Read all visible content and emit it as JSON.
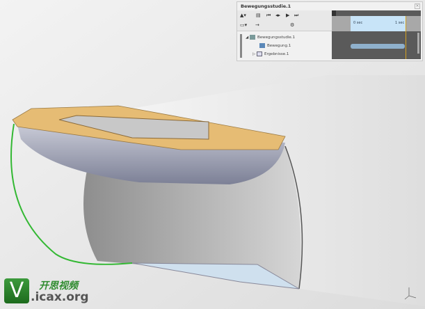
{
  "panel": {
    "title": "Bewegungsstudie.1",
    "close": "×",
    "toolbar": {
      "play_controls": [
        "⏮",
        "◂▸",
        "▶",
        "⏭"
      ],
      "arrow": "→",
      "gear": "⚙"
    },
    "tree": [
      {
        "label": "Bewegungsstudie.1",
        "expander": "◢"
      },
      {
        "label": "Bewegung.1",
        "expander": ""
      },
      {
        "label": "Ergebnisse.1",
        "expander": "▷"
      }
    ],
    "timeline": {
      "start_label": "0 sec",
      "end_label": "1 sec"
    }
  },
  "watermark": {
    "chinese": "开思视频",
    "domain": ".icax.org",
    "letter": "V"
  },
  "colors": {
    "accent_green": "#33b833",
    "deck": "#e8c07a",
    "hull": "#9a9eb0"
  }
}
